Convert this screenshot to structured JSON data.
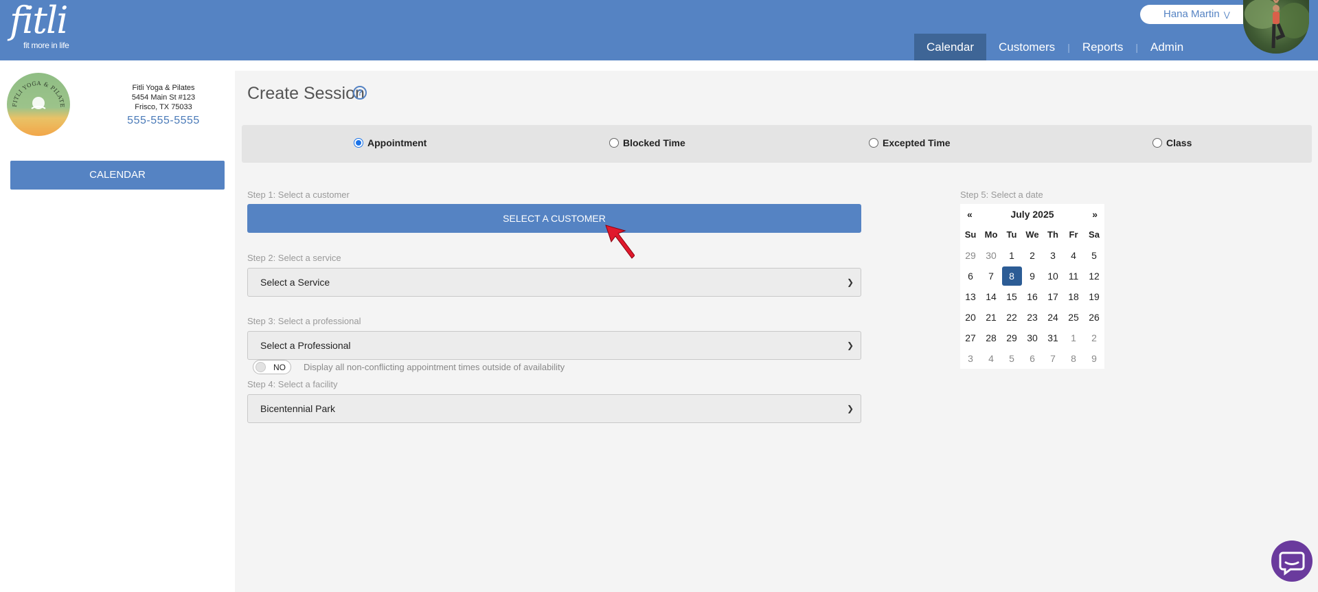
{
  "header": {
    "logo_word": "fitli",
    "logo_tagline": "fit more in life",
    "user_name": "Hana Martin",
    "nav": [
      {
        "label": "Calendar",
        "active": true
      },
      {
        "label": "Customers",
        "active": false
      },
      {
        "label": "Reports",
        "active": false
      },
      {
        "label": "Admin",
        "active": false
      }
    ]
  },
  "sidebar": {
    "studio_logo_text": "FITLI YOGA & PILATES",
    "address": [
      "Fitli Yoga & Pilates",
      "5454 Main St #123",
      "Frisco, TX 75033"
    ],
    "phone": "555-555-5555",
    "calendar_button": "CALENDAR"
  },
  "main": {
    "title": "Create Session",
    "help_icon": "?",
    "session_types": [
      {
        "label": "Appointment",
        "checked": true
      },
      {
        "label": "Blocked Time",
        "checked": false
      },
      {
        "label": "Excepted Time",
        "checked": false
      },
      {
        "label": "Class",
        "checked": false
      }
    ],
    "step1": {
      "label": "Step 1: Select a customer",
      "button": "SELECT A CUSTOMER"
    },
    "step2": {
      "label": "Step 2: Select a service",
      "value": "Select a Service"
    },
    "step3": {
      "label": "Step 3: Select a professional",
      "value": "Select a Professional"
    },
    "step4": {
      "label": "Step 4: Select a facility",
      "value": "Bicentennial Park"
    },
    "toggle": {
      "state": "NO",
      "description": "Display all non-conflicting appointment times outside of availability"
    },
    "step5": {
      "label": "Step 5: Select a date"
    }
  },
  "calendar": {
    "prev": "«",
    "next": "»",
    "month": "July 2025",
    "days_of_week": [
      "Su",
      "Mo",
      "Tu",
      "We",
      "Th",
      "Fr",
      "Sa"
    ],
    "weeks": [
      [
        "29",
        "30",
        "1",
        "2",
        "3",
        "4",
        "5"
      ],
      [
        "6",
        "7",
        "8",
        "9",
        "10",
        "11",
        "12"
      ],
      [
        "13",
        "14",
        "15",
        "16",
        "17",
        "18",
        "19"
      ],
      [
        "20",
        "21",
        "22",
        "23",
        "24",
        "25",
        "26"
      ],
      [
        "27",
        "28",
        "29",
        "30",
        "31",
        "1",
        "2"
      ],
      [
        "3",
        "4",
        "5",
        "6",
        "7",
        "8",
        "9"
      ]
    ],
    "selected": "8",
    "colors": {
      "selected": "#2c5c95",
      "accent": "#5583c3"
    }
  },
  "icons": {
    "chat": "chat-bubble-icon",
    "pointer": "arrow-pointer-icon",
    "help": "help-circle-icon"
  }
}
